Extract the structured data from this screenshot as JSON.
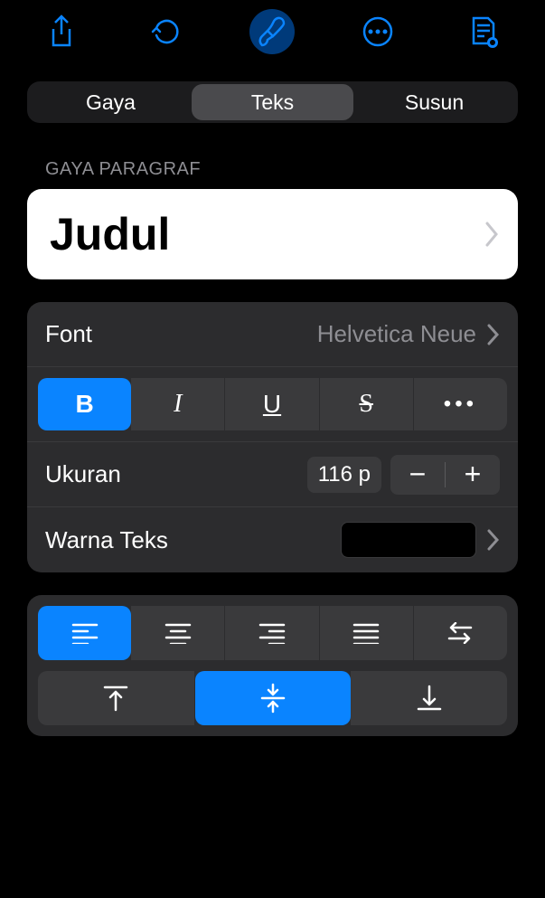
{
  "tabs": {
    "style": "Gaya",
    "text": "Teks",
    "arrange": "Susun"
  },
  "sections": {
    "paragraph_style": "GAYA PARAGRAF"
  },
  "paragraph_style": {
    "current": "Judul"
  },
  "font": {
    "label": "Font",
    "value": "Helvetica Neue"
  },
  "style_buttons": {
    "bold": "B",
    "italic": "I",
    "underline": "U",
    "strike": "S"
  },
  "size": {
    "label": "Ukuran",
    "value": "116 p"
  },
  "text_color": {
    "label": "Warna Teks",
    "value": "#000000"
  }
}
